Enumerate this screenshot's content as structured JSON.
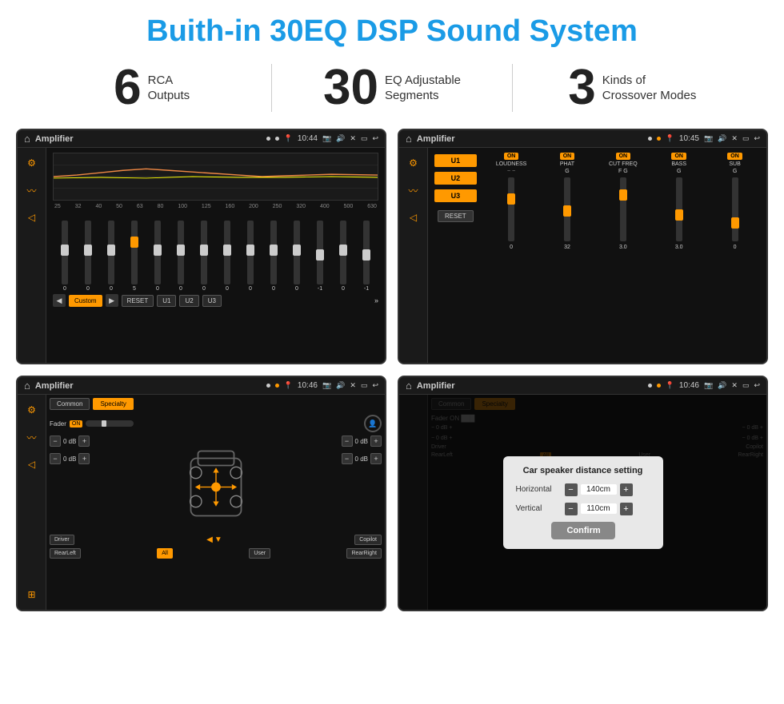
{
  "header": {
    "title": "Buith-in 30EQ DSP Sound System"
  },
  "stats": [
    {
      "number": "6",
      "label": "RCA\nOutputs"
    },
    {
      "number": "30",
      "label": "EQ Adjustable\nSegments"
    },
    {
      "number": "3",
      "label": "Kinds of\nCrossover Modes"
    }
  ],
  "screen1": {
    "status_title": "Amplifier",
    "time": "10:44",
    "freq_labels": [
      "25",
      "32",
      "40",
      "50",
      "63",
      "80",
      "100",
      "125",
      "160",
      "200",
      "250",
      "320",
      "400",
      "500",
      "630"
    ],
    "slider_values": [
      "0",
      "0",
      "0",
      "5",
      "0",
      "0",
      "0",
      "0",
      "0",
      "0",
      "0",
      "-1",
      "0",
      "-1"
    ],
    "bottom_btns": [
      "Custom",
      "RESET",
      "U1",
      "U2",
      "U3"
    ]
  },
  "screen2": {
    "status_title": "Amplifier",
    "time": "10:45",
    "u_buttons": [
      "U1",
      "U2",
      "U3"
    ],
    "on_labels": [
      "ON",
      "ON",
      "ON",
      "ON",
      "ON"
    ],
    "col_labels": [
      "LOUDNESS",
      "PHAT",
      "CUT FREQ",
      "BASS",
      "SUB"
    ],
    "reset_label": "RESET"
  },
  "screen3": {
    "status_title": "Amplifier",
    "time": "10:46",
    "tabs": [
      "Common",
      "Specialty"
    ],
    "fader_label": "Fader",
    "fader_on": "ON",
    "db_values": [
      "0 dB",
      "0 dB",
      "0 dB",
      "0 dB"
    ],
    "bottom_btns": [
      "Driver",
      "Copilot",
      "RearLeft",
      "All",
      "User",
      "RearRight"
    ]
  },
  "screen4": {
    "status_title": "Amplifier",
    "time": "10:46",
    "tabs": [
      "Common",
      "Specialty"
    ],
    "dialog": {
      "title": "Car speaker distance setting",
      "horizontal_label": "Horizontal",
      "horizontal_value": "140cm",
      "vertical_label": "Vertical",
      "vertical_value": "110cm",
      "confirm_label": "Confirm"
    }
  },
  "icons": {
    "home": "⌂",
    "back": "↩",
    "eq": "≡",
    "wave": "≈",
    "volume": "◁",
    "speaker": "⊞",
    "minus": "−",
    "plus": "+"
  }
}
